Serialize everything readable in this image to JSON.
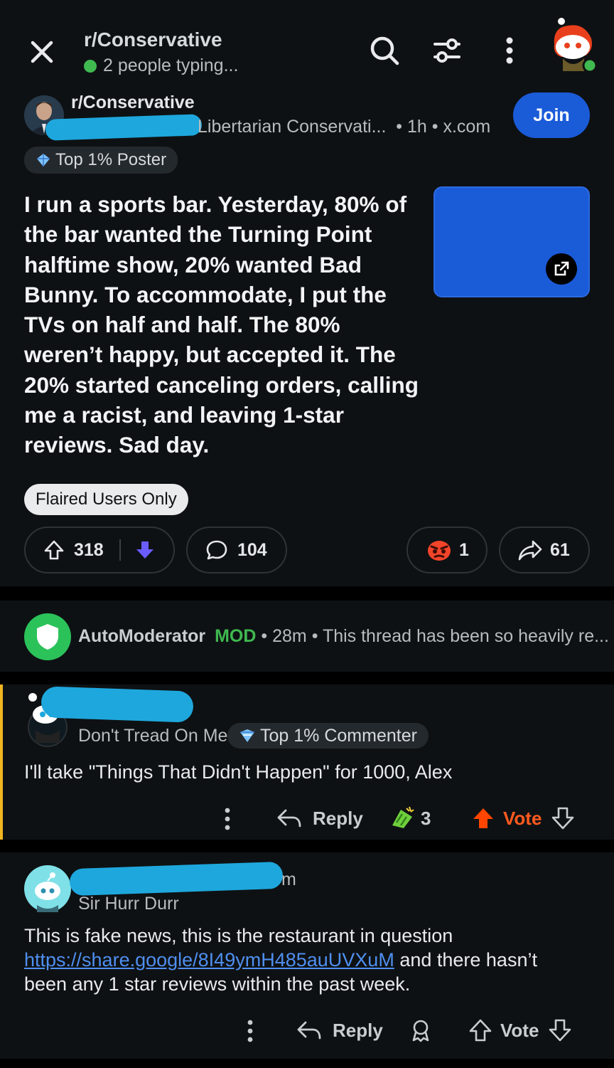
{
  "header": {
    "title": "r/Conservative",
    "status": "2 people typing..."
  },
  "post": {
    "subreddit": "r/Conservative",
    "author_flair": "Libertarian Conservati...",
    "time": "1h",
    "domain": "x.com",
    "join_label": "Join",
    "badge": "Top 1% Poster",
    "title": "I run a sports bar. Yesterday, 80% of the bar wanted the Turning Point halftime show, 20% wanted Bad Bunny. To accommodate, I put the TVs on half and half. The 80% weren’t happy, but accepted it. The 20% started canceling orders, calling me a racist, and leaving 1-star reviews. Sad day.",
    "post_flair": "Flaired Users Only",
    "upvotes": "318",
    "comments": "104",
    "awards": "1",
    "shares": "61"
  },
  "automod": {
    "name": "AutoModerator",
    "mod_tag": "MOD",
    "time": "28m",
    "preview": "This thread has been so heavily re..."
  },
  "comment1": {
    "user_flair": "Don't Tread On Me",
    "badge": "Top 1% Commenter",
    "body": "I'll take \"Things That Didn't Happen\" for 1000, Alex",
    "reply_label": "Reply",
    "award_count": "3",
    "vote_label": "Vote"
  },
  "comment2": {
    "time_fragment": "m",
    "user_flair": "Sir Hurr Durr",
    "body_start": "This is fake news, this is the restaurant in question",
    "link": "https://share.google/8I49ymH485auUVXuM",
    "body_end_inline": "and there hasn’t",
    "body_end": "been any 1 star reviews within the past week.",
    "reply_label": "Reply",
    "vote_label": "Vote"
  },
  "colors": {
    "accent_blue": "#1a5bd8",
    "upvote_orange": "#ff4500",
    "downvote_purple": "#6a5cff",
    "mod_green": "#3fb950",
    "redaction": "#1ea7dd"
  }
}
